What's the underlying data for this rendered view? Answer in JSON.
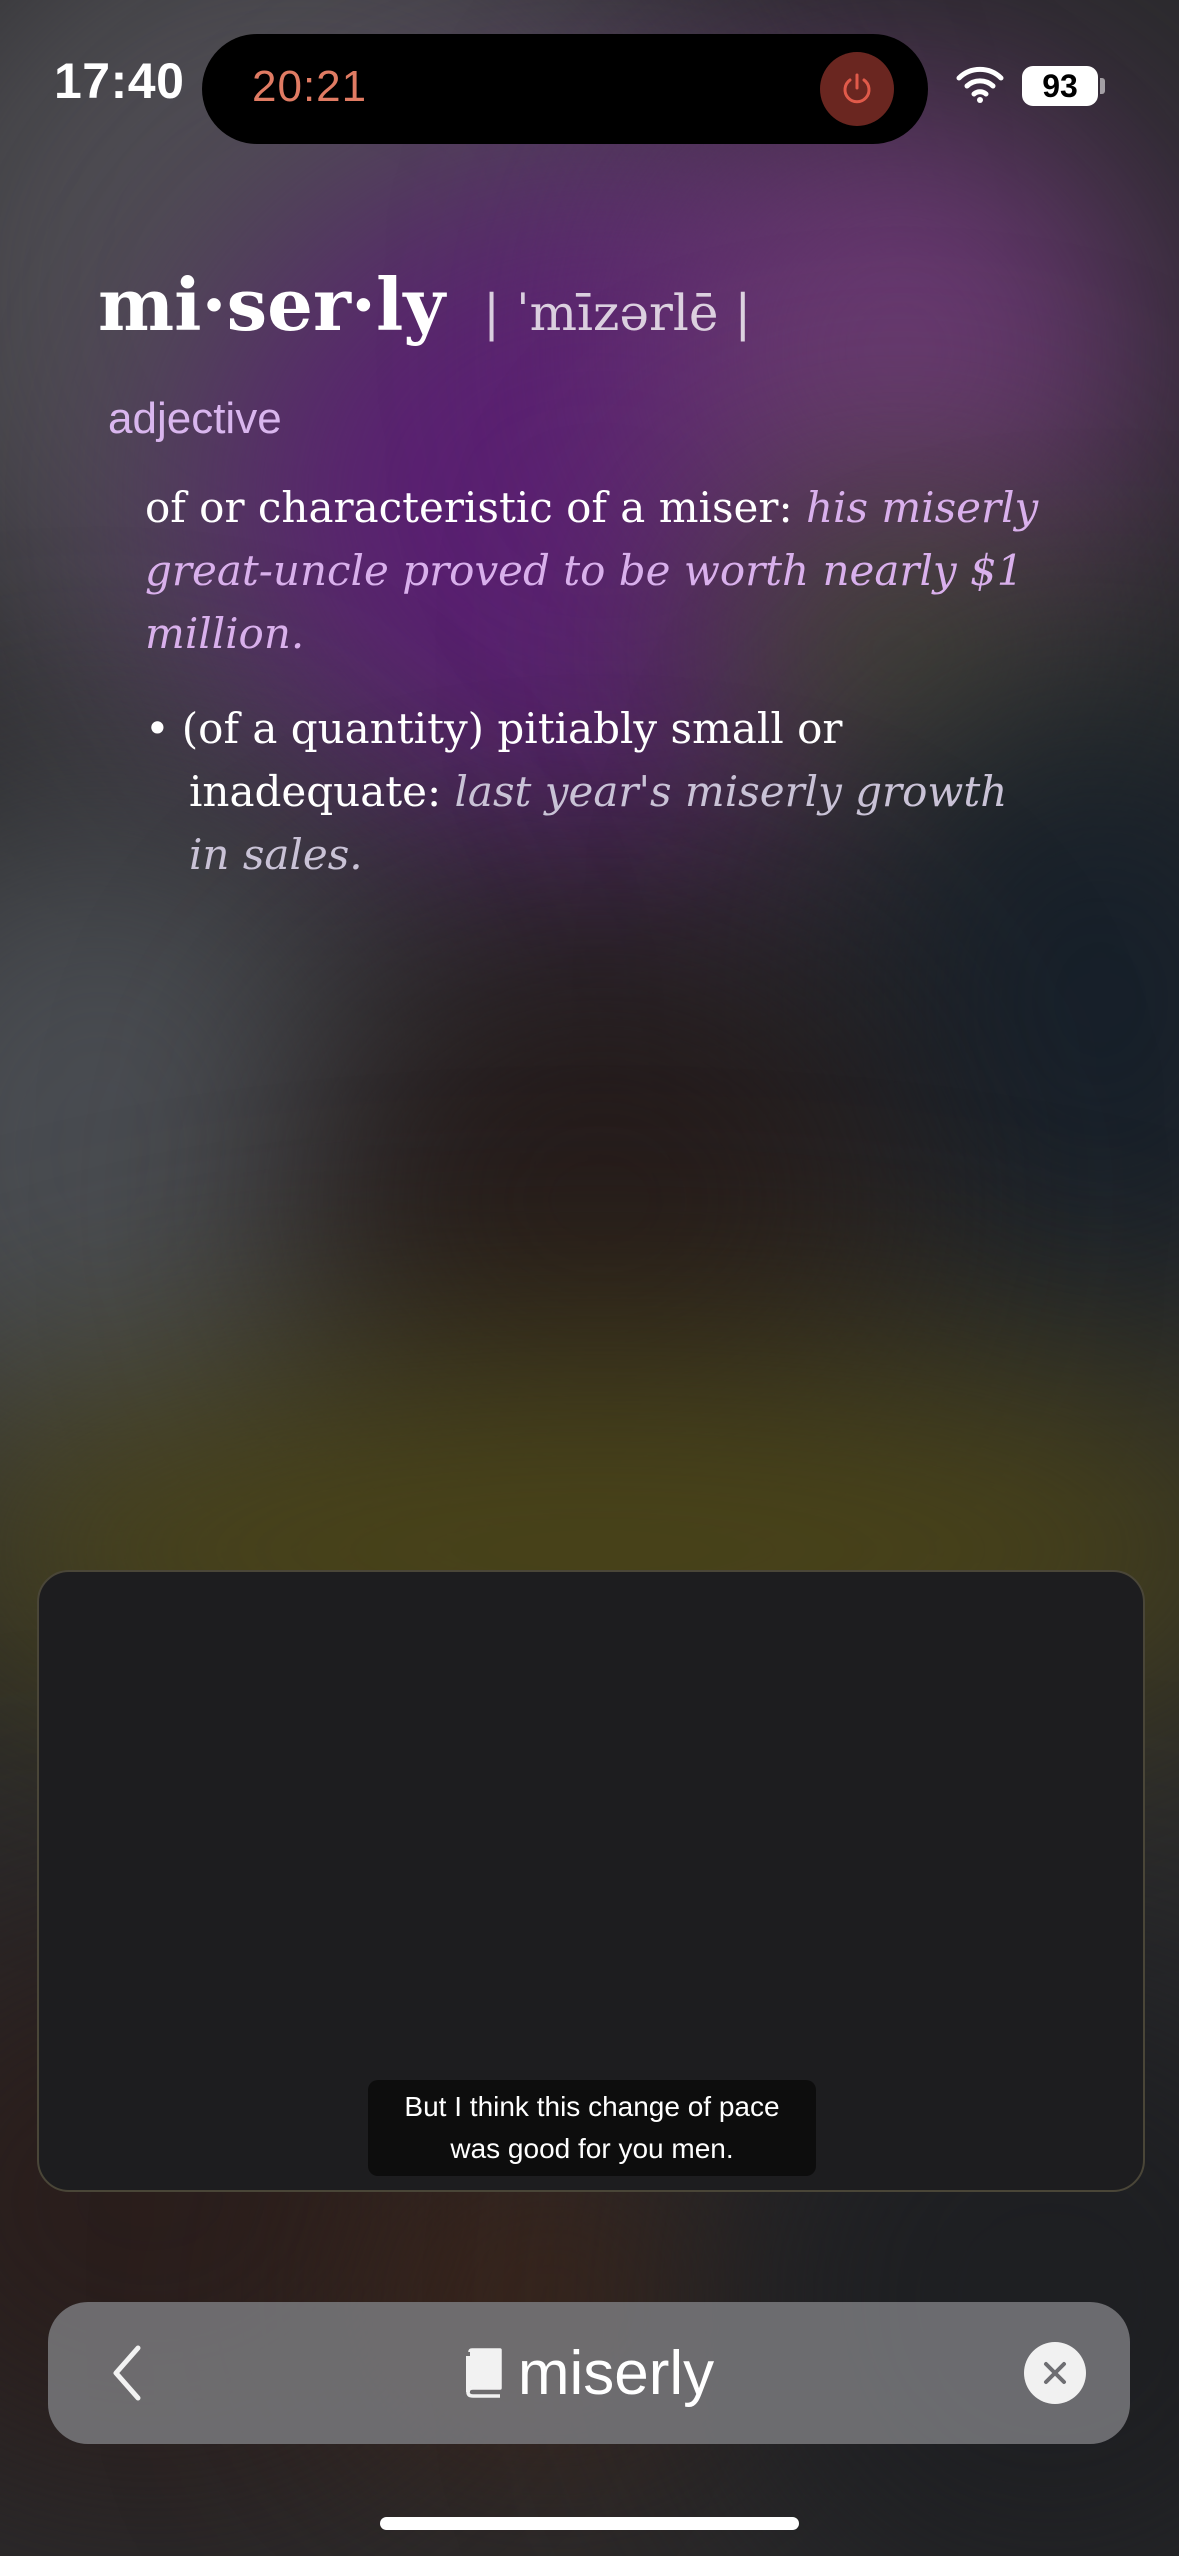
{
  "status_bar": {
    "time": "17:40",
    "island_timer": "20:21",
    "battery_level": "93",
    "icons": [
      "power-icon",
      "wifi-icon",
      "battery-icon"
    ],
    "timer_color": "#e07b63"
  },
  "entry": {
    "headword": "mi·ser·ly",
    "pronunciation": "| ˈmīzərlē |",
    "part_of_speech": "adjective",
    "senses": [
      {
        "definition": "of or characteristic of a miser",
        "separator": ": ",
        "example": "his miserly great-uncle proved to be worth nearly $1 million."
      },
      {
        "bullet": "•",
        "definition_line1": "(of a quantity) pitiably small or",
        "definition_line2": "inadequate",
        "separator": ": ",
        "example": "last year's miserly growth in sales."
      }
    ],
    "accent_color": "#d9b6ee"
  },
  "video": {
    "caption_line1": "But I think this change of pace",
    "caption_line2": "was good for you men."
  },
  "search_bar": {
    "query": "miserly",
    "icons": [
      "back-chevron-icon",
      "book-icon",
      "clear-icon"
    ]
  }
}
